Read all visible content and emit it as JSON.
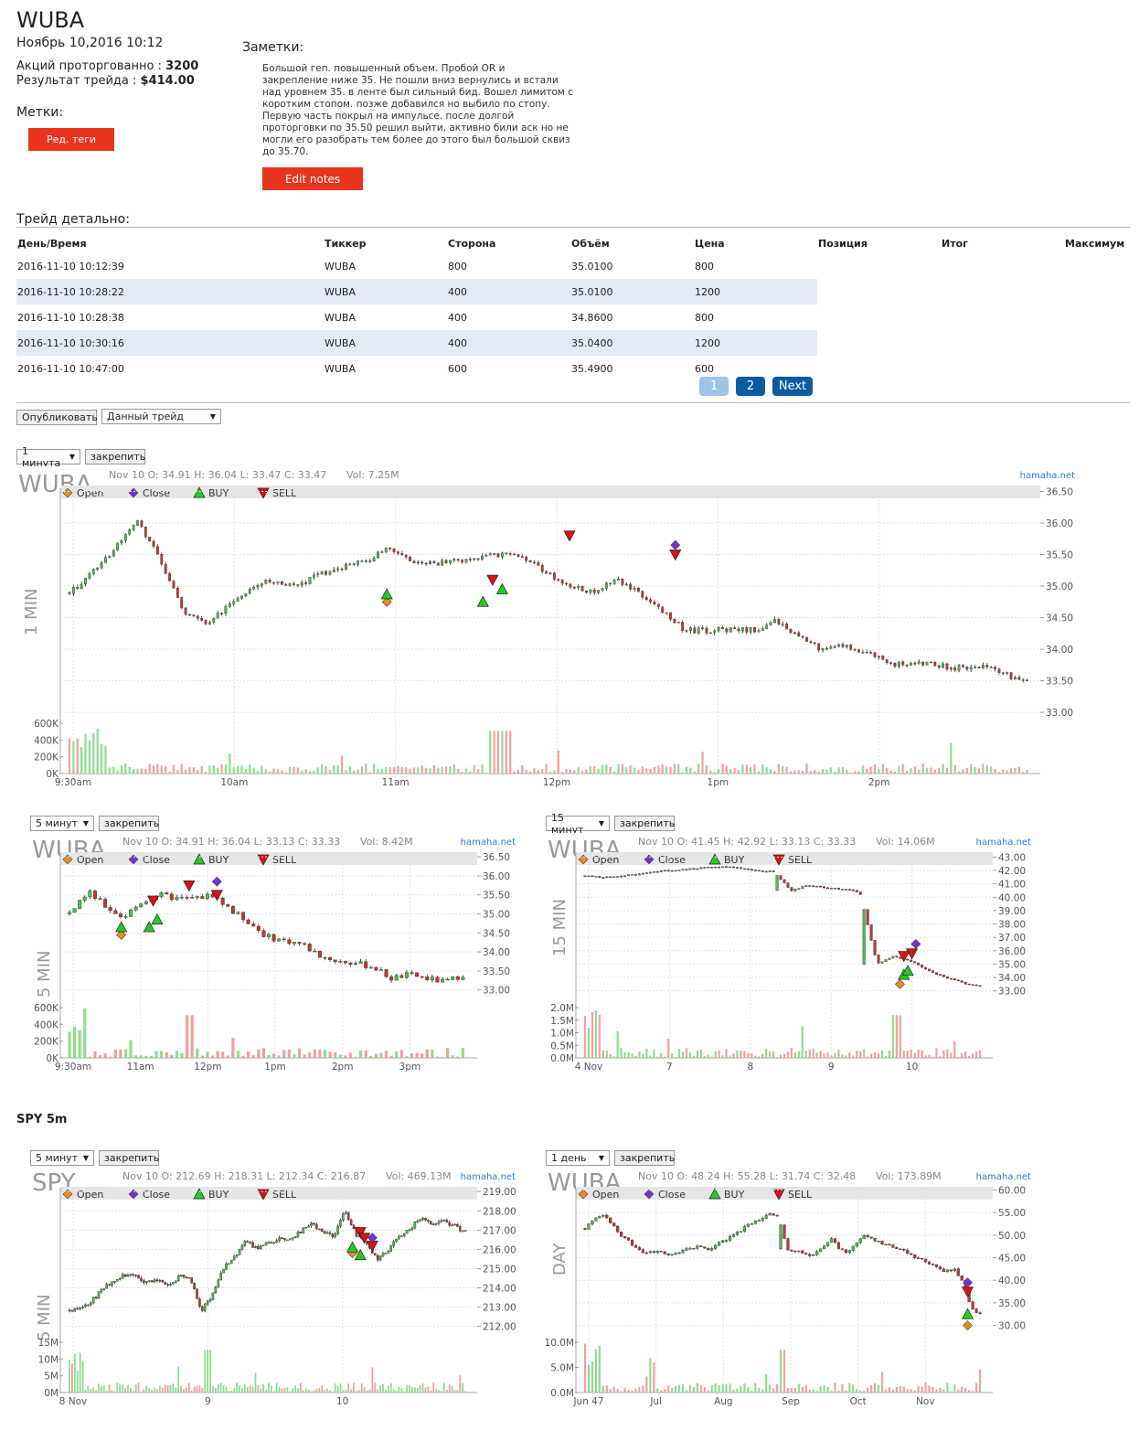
{
  "header": {
    "ticker": "WUBA",
    "datetime": "Ноябрь 10,2016 10:12",
    "shares_label": "Акций проторгованно :",
    "shares_value": "3200",
    "result_label": "Результат трейда :",
    "result_value": "$414.00",
    "tags_label": "Метки:",
    "tags_button": "Ред. теги"
  },
  "notes": {
    "label": "Заметки:",
    "text": "Большой геп. повышенный объем. Пробой OR и закрепление ниже 35. Не пошли вниз вернулись и встали над уровнем 35. в ленте был сильный бид. Вошел лимитом с коротким стопом. позже добавился но выбило по стопу. Первую часть покрыл на импульсе. после долгой проторговки по 35.50 решил выйти, активно били аск но не могли его разобрать тем более до этого был большой сквиз до 35.70.",
    "edit_button": "Edit notes"
  },
  "trade_detail": {
    "label": "Трейд детально:",
    "columns": [
      "День/Время",
      "Тиккер",
      "Сторона",
      "Объём",
      "Цена",
      "Позиция",
      "Итог",
      "Максимум"
    ],
    "rows": [
      [
        "2016-11-10 10:12:39",
        "WUBA",
        "800",
        "35.0100",
        "800"
      ],
      [
        "2016-11-10 10:28:22",
        "WUBA",
        "400",
        "35.0100",
        "1200"
      ],
      [
        "2016-11-10 10:28:38",
        "WUBA",
        "400",
        "34.8600",
        "800"
      ],
      [
        "2016-11-10 10:30:16",
        "WUBA",
        "400",
        "35.0400",
        "1200"
      ],
      [
        "2016-11-10 10:47:00",
        "WUBA",
        "600",
        "35.4900",
        "600"
      ]
    ],
    "pagination": [
      "1",
      "2",
      "Next"
    ]
  },
  "controls": {
    "publish_button": "Опубликовать",
    "trade_select": "Данный трейд"
  },
  "legend": {
    "open": "Open",
    "close": "Close",
    "buy": "BUY",
    "sell": "SELL"
  },
  "watermark": "hamaha.net",
  "pin_label": "закрепить",
  "section_spy": "SPY 5m",
  "colors": {
    "up": "#2ca02c",
    "down": "#d62728",
    "open_marker": "#f08a1e",
    "close_marker": "#7a2ed6",
    "buy_marker": "#22cc22",
    "sell_marker": "#dd1111",
    "accent": "#e8341c",
    "page_btn": "#0c5aa0"
  },
  "chart_data": [
    {
      "type": "candlestick",
      "id": "c1",
      "interval_select": "1 минута",
      "symbol": "WUBA",
      "ohlc": "Nov 10 O: 34.91 H: 36.04 L: 33.47 C: 33.47",
      "vol": "Vol: 7.25M",
      "side_label": "1 MIN",
      "ylim": [
        32.9,
        36.55
      ],
      "yticks": [
        "36.50",
        "36.00",
        "35.50",
        "35.00",
        "34.50",
        "34.00",
        "33.50",
        "33.00"
      ],
      "vol_ticks": [
        "600K",
        "400K",
        "200K",
        "0K"
      ],
      "xticks": [
        "9:30am",
        "10am",
        "11am",
        "12pm",
        "1pm",
        "2pm"
      ],
      "path": [
        34.9,
        35.2,
        35.6,
        36.0,
        35.4,
        34.6,
        34.4,
        34.7,
        35.0,
        35.1,
        35.0,
        35.2,
        35.3,
        35.4,
        35.6,
        35.4,
        35.35,
        35.4,
        35.45,
        35.5,
        35.45,
        35.2,
        35.0,
        34.9,
        35.1,
        34.9,
        34.6,
        34.3,
        34.3,
        34.3,
        34.3,
        34.45,
        34.2,
        34.0,
        34.05,
        33.95,
        33.75,
        33.8,
        33.75,
        33.7,
        33.75,
        33.6,
        33.5
      ],
      "markers": [
        {
          "kind": "open",
          "x": 0.33,
          "y": 34.75
        },
        {
          "kind": "buy",
          "x": 0.33,
          "y": 34.87
        },
        {
          "kind": "buy",
          "x": 0.43,
          "y": 34.75
        },
        {
          "kind": "buy",
          "x": 0.45,
          "y": 34.95
        },
        {
          "kind": "sell",
          "x": 0.44,
          "y": 35.1
        },
        {
          "kind": "sell",
          "x": 0.52,
          "y": 35.8
        },
        {
          "kind": "sell",
          "x": 0.63,
          "y": 35.5
        },
        {
          "kind": "close",
          "x": 0.63,
          "y": 35.65
        }
      ]
    },
    {
      "type": "candlestick",
      "id": "c2",
      "interval_select": "5 минут",
      "symbol": "WUBA",
      "ohlc": "Nov 10 O: 34.91 H: 36.04 L: 33.13 C: 33.33",
      "vol": "Vol: 8.42M",
      "side_label": "5 MIN",
      "ylim": [
        32.8,
        36.6
      ],
      "yticks": [
        "36.50",
        "36.00",
        "35.50",
        "35.00",
        "34.50",
        "34.00",
        "33.50",
        "33.00"
      ],
      "vol_ticks": [
        "600K",
        "400K",
        "200K",
        "0K"
      ],
      "xticks": [
        "9:30am",
        "11am",
        "12pm",
        "1pm",
        "2pm",
        "3pm"
      ],
      "path": [
        35.0,
        35.6,
        35.2,
        34.9,
        35.3,
        35.5,
        35.4,
        35.4,
        35.5,
        35.1,
        34.8,
        34.4,
        34.3,
        34.2,
        33.9,
        33.75,
        33.7,
        33.6,
        33.3,
        33.4,
        33.3,
        33.2,
        33.4
      ],
      "markers": [
        {
          "kind": "open",
          "x": 0.13,
          "y": 34.45
        },
        {
          "kind": "buy",
          "x": 0.13,
          "y": 34.65
        },
        {
          "kind": "buy",
          "x": 0.2,
          "y": 34.65
        },
        {
          "kind": "buy",
          "x": 0.22,
          "y": 34.85
        },
        {
          "kind": "sell",
          "x": 0.21,
          "y": 35.35
        },
        {
          "kind": "sell",
          "x": 0.3,
          "y": 35.75
        },
        {
          "kind": "sell",
          "x": 0.37,
          "y": 35.5
        },
        {
          "kind": "close",
          "x": 0.37,
          "y": 35.85
        }
      ]
    },
    {
      "type": "candlestick",
      "id": "c3",
      "interval_select": "15 минут",
      "symbol": "WUBA",
      "ohlc": "Nov 10 O: 41.45 H: 42.92 L: 33.13 C: 33.33",
      "vol": "Vol: 14.06M",
      "side_label": "15 MIN",
      "ylim": [
        32.5,
        43.3
      ],
      "yticks": [
        "43.00",
        "42.00",
        "41.00",
        "40.00",
        "39.00",
        "38.00",
        "37.00",
        "36.00",
        "35.00",
        "34.00",
        "33.00"
      ],
      "vol_ticks": [
        "2.0M",
        "1.5M",
        "1.0M",
        "0.5M",
        "0.0M"
      ],
      "xticks": [
        "4 Nov",
        "7",
        "8",
        "9",
        "10"
      ],
      "path": [
        41.6,
        41.5,
        41.6,
        41.7,
        41.9,
        42.0,
        42.1,
        42.2,
        42.3,
        42.2,
        42.0,
        41.9,
        40.5,
        40.9,
        40.7,
        40.6,
        40.4,
        35.0,
        35.6,
        35.2,
        34.5,
        34.0,
        33.6,
        33.3
      ],
      "gap_after": [
        11,
        16
      ],
      "markers": [
        {
          "kind": "open",
          "x": 0.79,
          "y": 33.5
        },
        {
          "kind": "buy",
          "x": 0.8,
          "y": 34.2
        },
        {
          "kind": "buy",
          "x": 0.81,
          "y": 34.5
        },
        {
          "kind": "sell",
          "x": 0.8,
          "y": 35.6
        },
        {
          "kind": "sell",
          "x": 0.82,
          "y": 35.8
        },
        {
          "kind": "close",
          "x": 0.83,
          "y": 36.5
        }
      ]
    },
    {
      "type": "candlestick",
      "id": "c4",
      "interval_select": "5 минут",
      "symbol": "SPY",
      "ohlc": "Nov 10 O: 212.69 H: 218.31 L: 212.34 C: 216.87",
      "vol": "Vol: 469.13M",
      "side_label": "5 MIN",
      "ylim": [
        211.7,
        219.2
      ],
      "yticks": [
        "219.00",
        "218.00",
        "217.00",
        "216.00",
        "215.00",
        "214.00",
        "213.00",
        "212.00"
      ],
      "vol_ticks": [
        "15M",
        "10M",
        "5M",
        "0M"
      ],
      "xticks": [
        "8 Nov",
        "9",
        "10"
      ],
      "path": [
        212.8,
        212.9,
        213.3,
        213.9,
        214.4,
        214.7,
        214.6,
        214.3,
        214.4,
        214.2,
        214.6,
        214.5,
        212.8,
        213.6,
        215.0,
        215.6,
        216.5,
        216.0,
        216.3,
        216.5,
        216.6,
        216.9,
        217.3,
        216.9,
        216.7,
        218.0,
        216.8,
        216.2,
        215.5,
        216.0,
        216.7,
        217.1,
        217.7,
        217.3,
        217.5,
        217.2,
        216.9
      ],
      "markers": [
        {
          "kind": "open",
          "x": 0.71,
          "y": 215.8
        },
        {
          "kind": "buy",
          "x": 0.71,
          "y": 216.1
        },
        {
          "kind": "buy",
          "x": 0.73,
          "y": 215.7
        },
        {
          "kind": "sell",
          "x": 0.73,
          "y": 216.9
        },
        {
          "kind": "sell",
          "x": 0.74,
          "y": 216.6
        },
        {
          "kind": "sell",
          "x": 0.76,
          "y": 216.2
        },
        {
          "kind": "close",
          "x": 0.76,
          "y": 216.6
        }
      ]
    },
    {
      "type": "candlestick",
      "id": "c5",
      "interval_select": "1 день",
      "symbol": "WUBA",
      "ohlc": "Nov 10 O: 48.24 H: 55.28 L: 31.74 C: 32.48",
      "vol": "Vol: 173.89M",
      "side_label": "DAY",
      "ylim": [
        28.5,
        60.5
      ],
      "yticks": [
        "60.00",
        "55.00",
        "50.00",
        "45.00",
        "40.00",
        "35.00",
        "30.00"
      ],
      "vol_ticks": [
        "10.0M",
        "5.0M",
        "0.0M"
      ],
      "xticks": [
        "Jun 47",
        "Jul",
        "Aug",
        "Sep",
        "Oct",
        "Nov"
      ],
      "path": [
        51.5,
        53.5,
        54.5,
        52.5,
        50.0,
        48.5,
        47.0,
        46.0,
        46.5,
        46.0,
        45.5,
        46.5,
        47.0,
        47.5,
        46.5,
        48.0,
        49.0,
        50.0,
        51.5,
        52.5,
        53.5,
        54.5,
        54.0,
        47.0,
        46.5,
        46.0,
        45.5,
        47.0,
        49.5,
        47.0,
        46.0,
        48.5,
        50.0,
        49.0,
        48.0,
        47.5,
        47.0,
        45.5,
        45.0,
        44.0,
        43.0,
        42.0,
        42.5,
        40.0,
        33.5,
        32.5
      ],
      "gap_after": [
        22
      ],
      "markers": [
        {
          "kind": "open",
          "x": 0.96,
          "y": 30.0
        },
        {
          "kind": "buy",
          "x": 0.96,
          "y": 32.5
        },
        {
          "kind": "sell",
          "x": 0.96,
          "y": 37.5
        },
        {
          "kind": "close",
          "x": 0.96,
          "y": 39.5
        }
      ]
    }
  ]
}
